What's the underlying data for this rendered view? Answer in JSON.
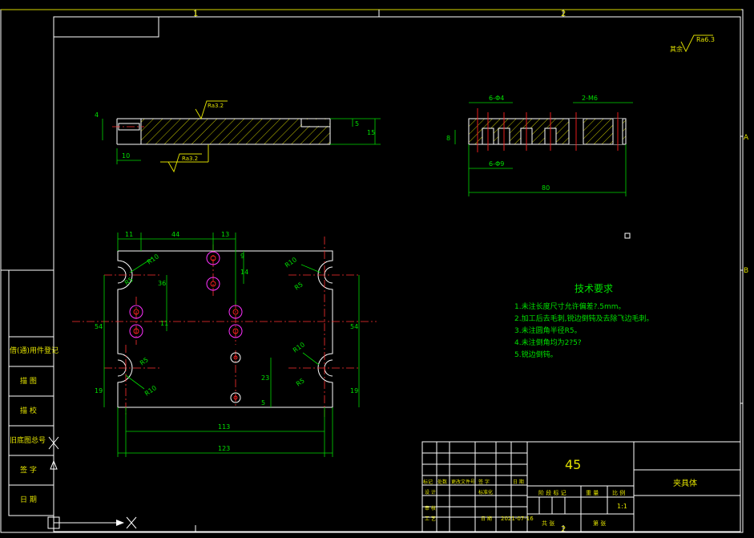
{
  "border": {
    "zones_top": [
      "1",
      "2"
    ],
    "zones_bottom": [
      "2"
    ],
    "zones_right": [
      "A",
      "B"
    ]
  },
  "roughness": {
    "general": "Ra6.3",
    "general_prefix": "其余",
    "face_top": "Ra3.2",
    "face_bottom": "Ra3.2"
  },
  "side_view_dims": {
    "d4": "4",
    "d10": "10",
    "d5": "5",
    "d15": "15"
  },
  "section_view_dims": {
    "holes_top": "6-Φ4",
    "thread": "2-M6",
    "depth": "8",
    "holes_bottom": "6-Φ9",
    "length": "80"
  },
  "plan_view_dims": {
    "d11": "11",
    "d44": "44",
    "d13": "13",
    "d9": "9",
    "d14": "14",
    "d36": "36",
    "d11b": "11",
    "d54_left": "54",
    "d54_right": "54",
    "d19_left": "19",
    "d19_right": "19",
    "d23": "23",
    "d5": "5",
    "d113": "113",
    "d123": "123",
    "r10_a": "R10",
    "r10_b": "R10",
    "r10_c": "R10",
    "r10_d": "R10",
    "r5_a": "R5",
    "r5_b": "R5",
    "r5_c": "R5",
    "r5_d": "R5"
  },
  "tech_requirements": {
    "title": "技术要求",
    "items": [
      "1.未注长度尺寸允许偏差?.5mm。",
      "2.加工后去毛刺,锐边倒钝及去除飞边毛刺。",
      "3.未注圆角半径R5。",
      "4.未注倒角均为2?5?",
      "5.锐边倒钝。"
    ]
  },
  "left_strip": {
    "labels": [
      "借(通)用件登记",
      "描 图",
      "描 校",
      "旧底图总号",
      "签 字",
      "日 期"
    ]
  },
  "title_block": {
    "material": "45",
    "part_name": "夹具体",
    "scale": "1:1",
    "date": "2021-07-16",
    "headers": [
      "标记",
      "处数",
      "更改文件号",
      "签 字",
      "日 期"
    ],
    "roles": [
      "设 计",
      "标准化",
      "审 核",
      "工 艺",
      "日 期"
    ],
    "stage_headers": [
      "阶 段 标 记",
      "重 量",
      "比 例"
    ],
    "footer": [
      "共 张",
      "第 张"
    ]
  }
}
